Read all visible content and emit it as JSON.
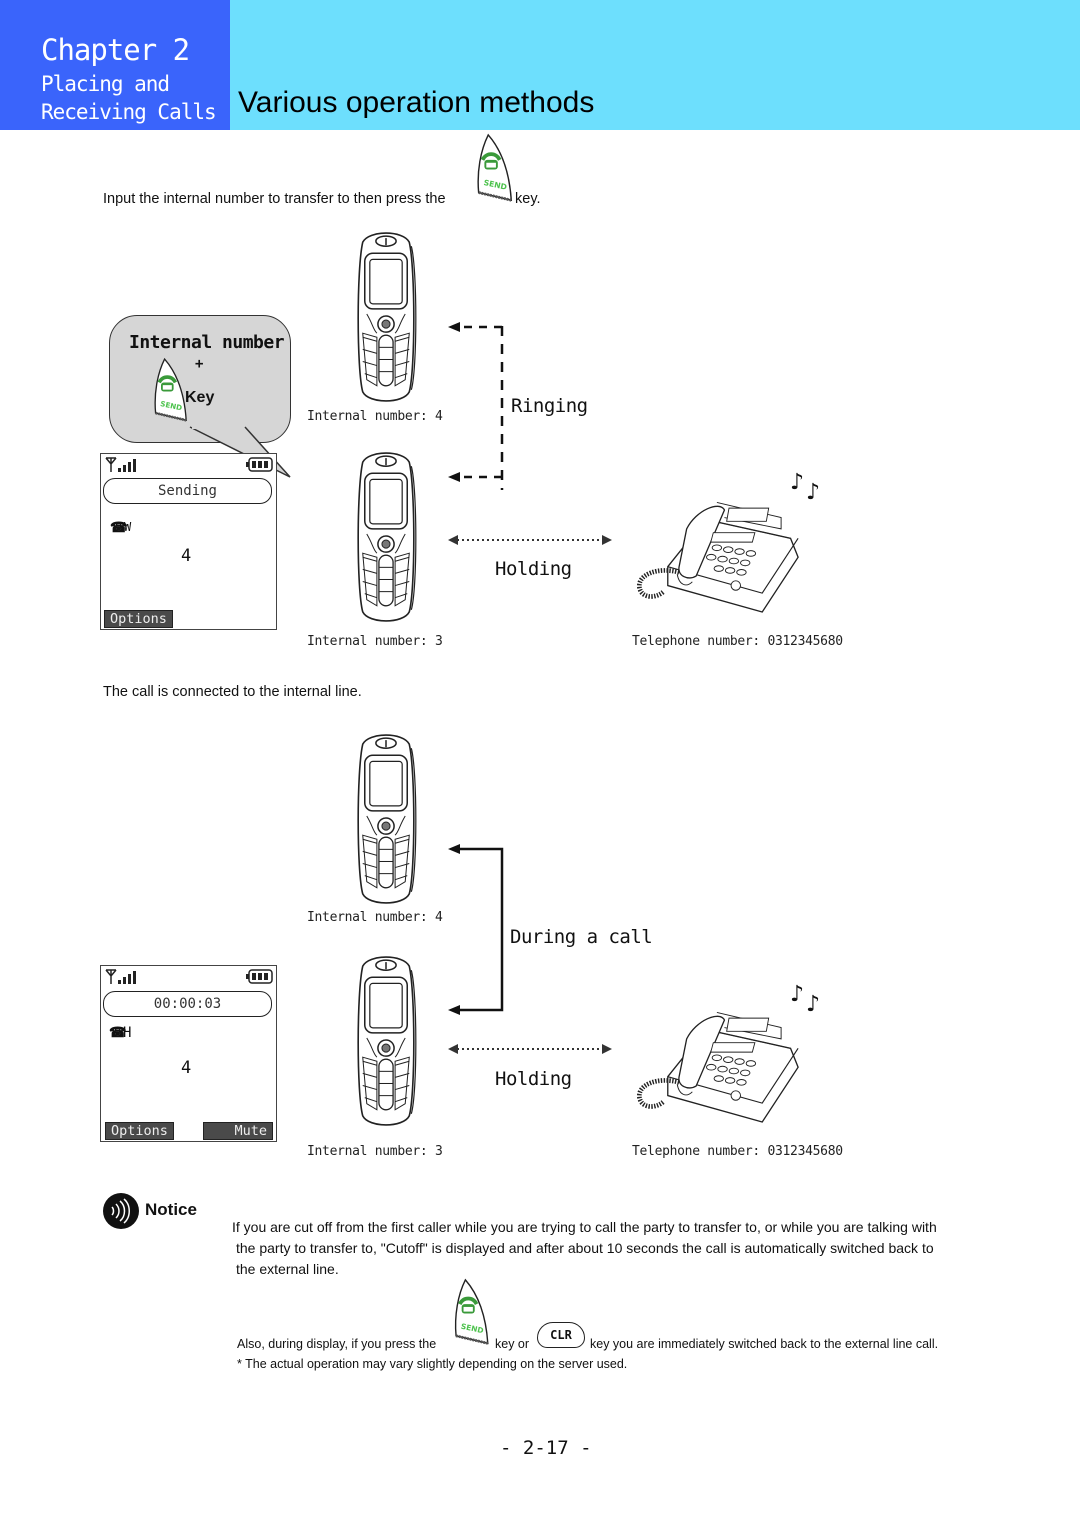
{
  "header": {
    "chapter": "Chapter 2",
    "chapter_sub_line1": "Placing and",
    "chapter_sub_line2": "Receiving Calls",
    "page_title": "Various operation methods",
    "colors": {
      "left_band": "#3a64fb",
      "right_band": "#6ddffd"
    }
  },
  "section1": {
    "instruction_before": "Input the internal number to transfer to then press the",
    "instruction_after": "key.",
    "bubble": {
      "line1": "Internal number",
      "plus": "+",
      "key": "Key"
    },
    "screen": {
      "status": "Sending",
      "line_indicator": "W",
      "number": "4",
      "softkey_left": "Options"
    },
    "handset_top_label": "Internal number:  4",
    "handset_bottom_label": "Internal number:  3",
    "ringing_label": "Ringing",
    "holding_label": "Holding",
    "desk_phone_label": "Telephone number:  0312345680"
  },
  "section2": {
    "intro": "The call is connected to the internal  line.",
    "screen": {
      "status": "00:00:03",
      "line_indicator": "H",
      "number": "4",
      "softkey_left": "Options",
      "softkey_right": "Mute"
    },
    "handset_top_label": "Internal number:  4",
    "handset_bottom_label": "Internal number:  3",
    "during_call_label": "During a call",
    "holding_label": "Holding",
    "desk_phone_label": "Telephone number:  0312345680"
  },
  "notice": {
    "title": "Notice",
    "para_line1": "If you are cut off from the first caller while you are trying to call the party to transfer to, or while you are talking with",
    "para_line2": "the party to transfer to, \"Cutoff\" is displayed and after about 10 seconds the call is automatically switched back to",
    "para_line3": "the external line.",
    "also_before": "Also, during display, if you press the",
    "also_middle": "key or",
    "clr_label": "CLR",
    "also_after": "key you are immediately switched back to the external line call.",
    "footnote": "* The actual operation may vary slightly depending on the server used."
  },
  "footer": {
    "page_number": "- 2-17 -"
  }
}
